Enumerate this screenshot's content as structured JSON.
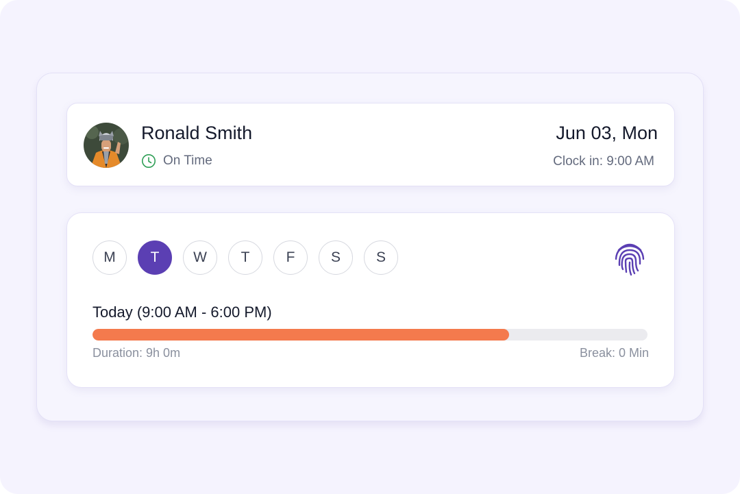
{
  "profile": {
    "name": "Ronald Smith",
    "status": "On Time",
    "date": "Jun 03, Mon",
    "clock_in": "Clock in: 9:00 AM"
  },
  "schedule": {
    "days": [
      {
        "label": "M",
        "active": false
      },
      {
        "label": "T",
        "active": true
      },
      {
        "label": "W",
        "active": false
      },
      {
        "label": "T",
        "active": false
      },
      {
        "label": "F",
        "active": false
      },
      {
        "label": "S",
        "active": false
      },
      {
        "label": "S",
        "active": false
      }
    ],
    "today_label": "Today (9:00 AM - 6:00 PM)",
    "progress_fraction": 0.75,
    "duration": "Duration: 9h 0m",
    "break": "Break: 0 Min"
  },
  "colors": {
    "accent": "#5b3fb3",
    "progress": "#f47a4d",
    "status_ok": "#2e9e55"
  },
  "icons": {
    "status": "clock-icon",
    "biometric": "fingerprint-icon"
  }
}
